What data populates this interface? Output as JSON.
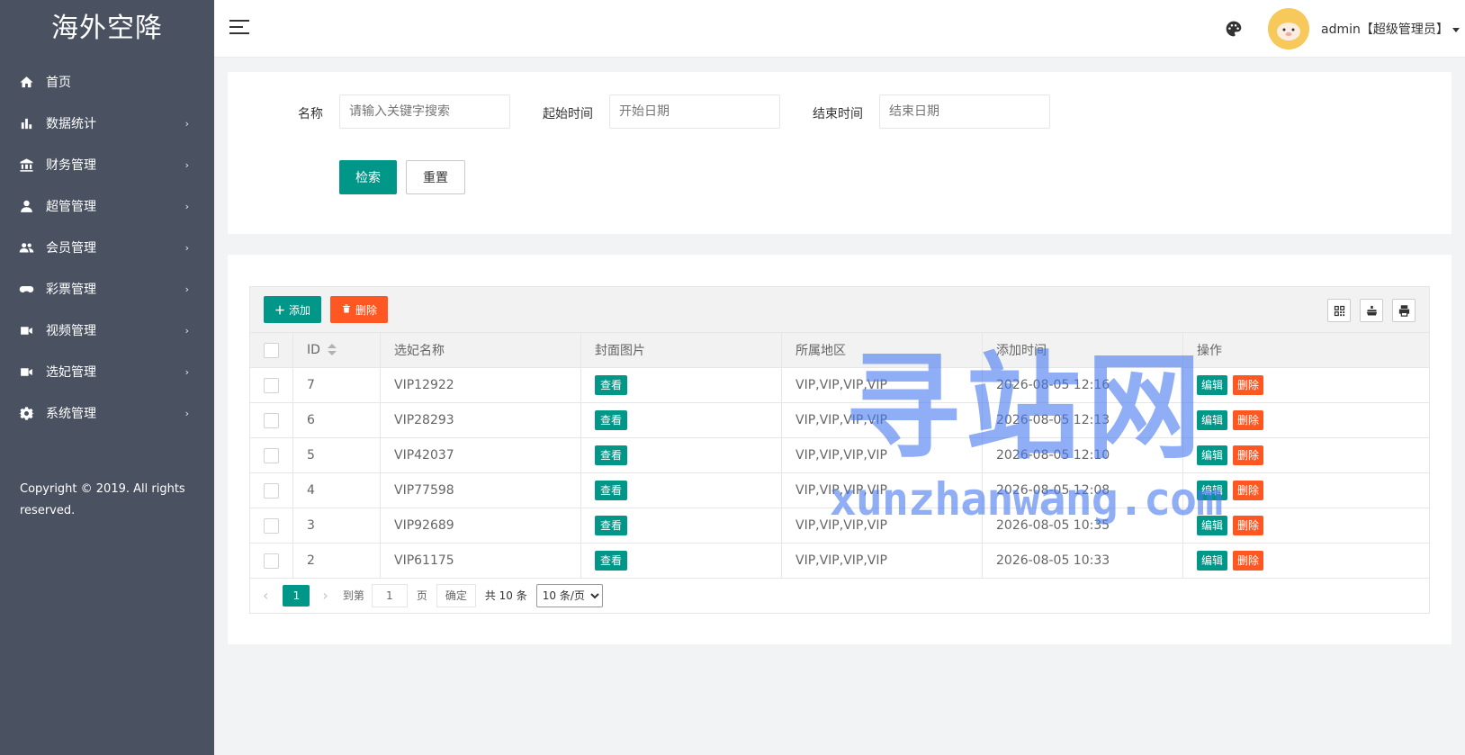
{
  "sidebar": {
    "logo": "海外空降",
    "items": [
      {
        "label": "首页",
        "icon": "home-icon",
        "arrow": ""
      },
      {
        "label": "数据统计",
        "icon": "bar-chart-icon",
        "arrow": "›"
      },
      {
        "label": "财务管理",
        "icon": "bank-icon",
        "arrow": "›"
      },
      {
        "label": "超管管理",
        "icon": "user-icon",
        "arrow": "›"
      },
      {
        "label": "会员管理",
        "icon": "users-icon",
        "arrow": "›"
      },
      {
        "label": "彩票管理",
        "icon": "gamepad-icon",
        "arrow": "›"
      },
      {
        "label": "视频管理",
        "icon": "video-camera-icon",
        "arrow": "›"
      },
      {
        "label": "选妃管理",
        "icon": "video-camera-icon",
        "arrow": "›"
      },
      {
        "label": "系统管理",
        "icon": "gear-icon",
        "arrow": "›"
      }
    ],
    "copyright": "Copyright © 2019. All rights reserved."
  },
  "header": {
    "user_label": "admin【超级管理员】"
  },
  "search": {
    "name_label": "名称",
    "name_placeholder": "请输入关键字搜索",
    "start_label": "起始时间",
    "start_placeholder": "开始日期",
    "end_label": "结束时间",
    "end_placeholder": "结束日期",
    "search_button": "检索",
    "reset_button": "重置"
  },
  "toolbar": {
    "add_label": "添加",
    "delete_label": "删除"
  },
  "table": {
    "columns": [
      "ID",
      "选妃名称",
      "封面图片",
      "所属地区",
      "添加时间",
      "操作"
    ],
    "view_label": "查看",
    "edit_label": "编辑",
    "delete_label": "删除",
    "rows": [
      {
        "id": "7",
        "name": "VIP12922",
        "region": "VIP,VIP,VIP,VIP",
        "time": "2026-08-05 12:16"
      },
      {
        "id": "6",
        "name": "VIP28293",
        "region": "VIP,VIP,VIP,VIP",
        "time": "2026-08-05 12:13"
      },
      {
        "id": "5",
        "name": "VIP42037",
        "region": "VIP,VIP,VIP,VIP",
        "time": "2026-08-05 12:10"
      },
      {
        "id": "4",
        "name": "VIP77598",
        "region": "VIP,VIP,VIP,VIP",
        "time": "2026-08-05 12:08"
      },
      {
        "id": "3",
        "name": "VIP92689",
        "region": "VIP,VIP,VIP,VIP",
        "time": "2026-08-05 10:35"
      },
      {
        "id": "2",
        "name": "VIP61175",
        "region": "VIP,VIP,VIP,VIP",
        "time": "2026-08-05 10:33"
      }
    ]
  },
  "pager": {
    "current_page": "1",
    "goto_label": "到第",
    "goto_value": "1",
    "page_unit": "页",
    "confirm_label": "确定",
    "total_label": "共 10 条",
    "page_size": "10 条/页"
  },
  "watermark": {
    "cn": "寻站网",
    "en": "xunzhanwang.com"
  },
  "colors": {
    "sidebar_bg": "#4a5262",
    "primary": "#009688",
    "danger": "#ff5722",
    "watermark": "#4678f0"
  }
}
